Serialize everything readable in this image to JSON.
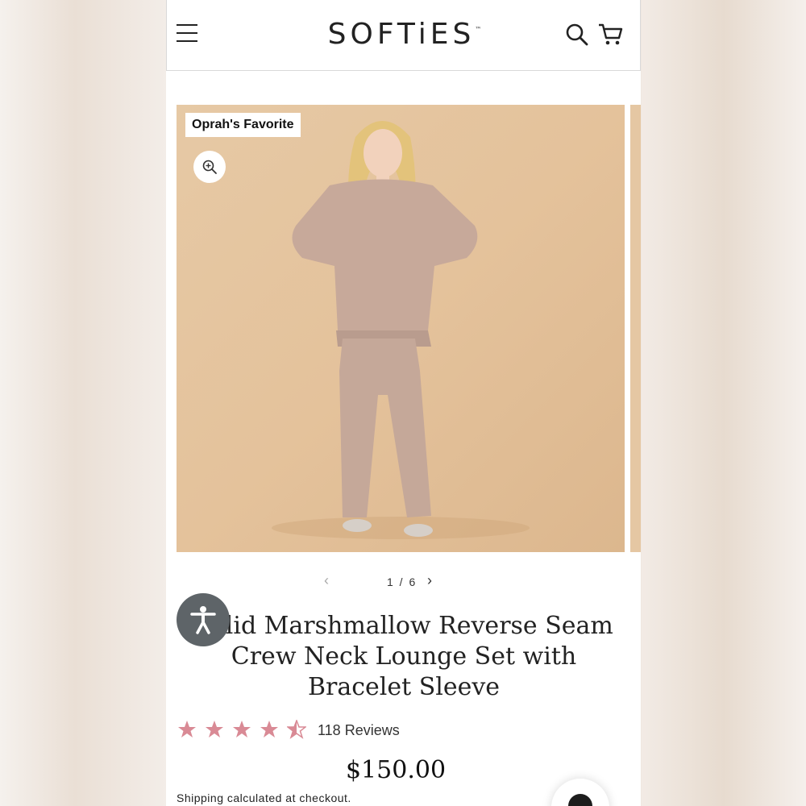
{
  "header": {
    "logo": "SOFTiES",
    "logo_tm": "™"
  },
  "gallery": {
    "badge": "Oprah's Favorite",
    "counter": "1 / 6",
    "prev": "‹",
    "next": "›"
  },
  "product": {
    "title": "Solid Marshmallow Reverse Seam Crew Neck Lounge Set with Bracelet Sleeve",
    "rating": 4.5,
    "rating_max": 5,
    "reviews": "118 Reviews",
    "price": "$150.00",
    "shipping": "Shipping calculated at checkout."
  },
  "colors": {
    "star": "#d98a95",
    "accessibility": "#5e6468",
    "hero_bg": "#e4c29b"
  },
  "icons": [
    "menu-icon",
    "search-icon",
    "cart-icon",
    "zoom-in-icon",
    "accessibility-icon",
    "chat-icon"
  ]
}
